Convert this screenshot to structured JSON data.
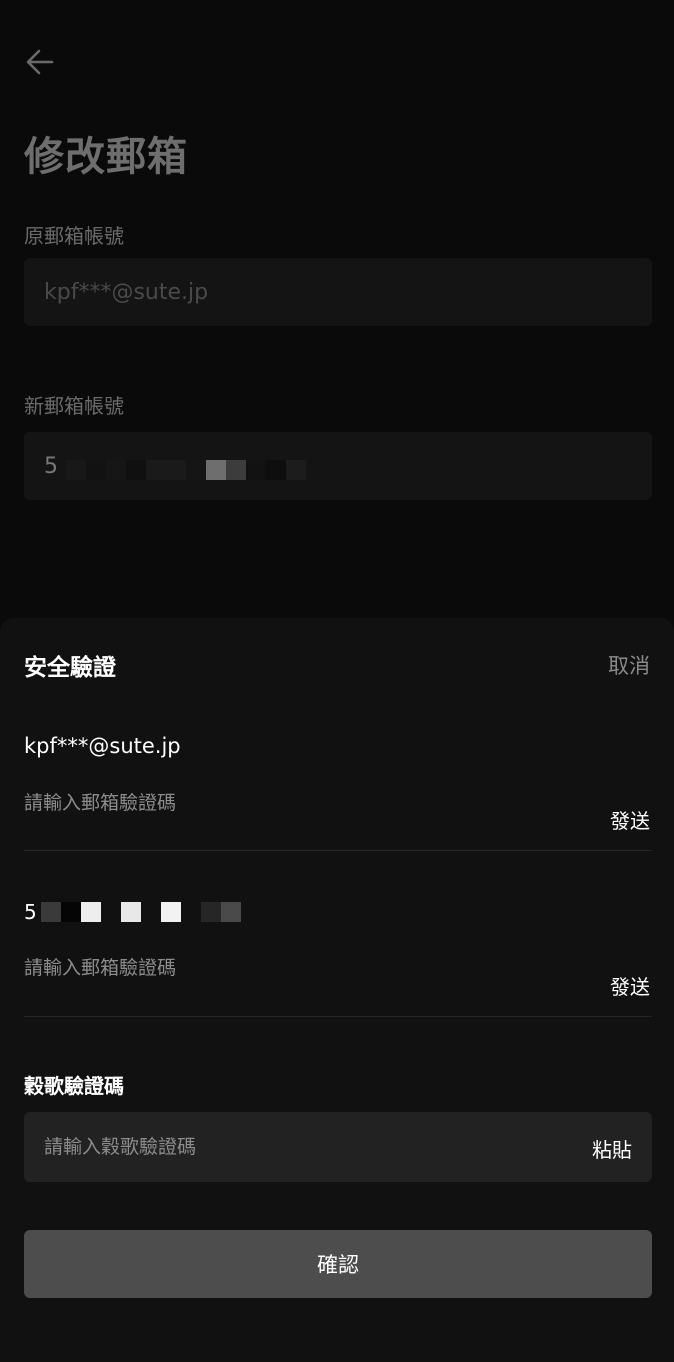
{
  "background_page": {
    "title": "修改郵箱",
    "old_email_label": "原郵箱帳號",
    "old_email_value": "kpf***@sute.jp",
    "new_email_label": "新郵箱帳號",
    "new_email_prefix": "5"
  },
  "sheet": {
    "title": "安全驗證",
    "cancel_label": "取消",
    "email_verify_1": {
      "email": "kpf***@sute.jp",
      "placeholder": "請輸入郵箱驗證碼",
      "send_label": "發送"
    },
    "email_verify_2": {
      "email_prefix": "5",
      "placeholder": "請輸入郵箱驗證碼",
      "send_label": "發送"
    },
    "google": {
      "label": "穀歌驗證碼",
      "placeholder": "請輸入穀歌驗證碼",
      "paste_label": "粘貼"
    },
    "confirm_label": "確認"
  },
  "icons": {
    "back": "arrow-left-icon"
  },
  "colors": {
    "sheet_bg": "#111111",
    "input_bg": "#222222",
    "confirm_bg": "#4d4d4d"
  }
}
